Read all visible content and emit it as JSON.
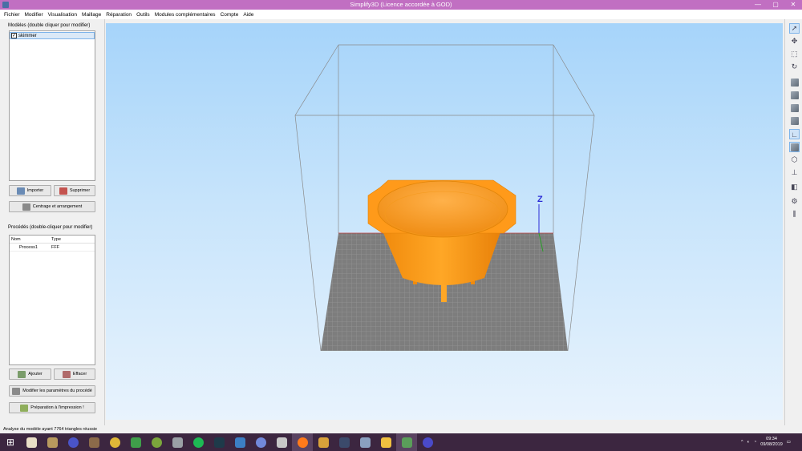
{
  "window": {
    "title": "Simplify3D (Licence accordée à GOD)",
    "controls": [
      "—",
      "▢",
      "✕"
    ]
  },
  "menu": [
    "Fichier",
    "Modifier",
    "Visualisation",
    "Maillage",
    "Réparation",
    "Outils",
    "Modules complémentaires",
    "Compte",
    "Aide"
  ],
  "models": {
    "title": "Modèles (double cliquer pour modifier)",
    "items": [
      {
        "name": "skimmer",
        "checked": true
      }
    ],
    "import_label": "Importer",
    "delete_label": "Supprimer",
    "arrange_label": "Centrage et arrangement"
  },
  "processes": {
    "title": "Procédés (double-cliquer pour modifier)",
    "col_name": "Nom",
    "col_type": "Type",
    "rows": [
      {
        "name": "Process1",
        "type": "FFF"
      }
    ],
    "add_label": "Ajouter",
    "clear_label": "Effacer",
    "edit_label": "Modifier les paramètres du procédé",
    "prepare_label": "Préparation à l'impression !"
  },
  "viewport": {
    "axis_label": "Z",
    "model_color": "#ff9a1a",
    "bed_color": "#7d7d7d"
  },
  "toolbar_icons": [
    "select-icon",
    "move-icon",
    "scale-icon",
    "rotate-icon",
    "view-default-icon",
    "view-front-icon",
    "view-top-icon",
    "view-side-icon",
    "axes-icon",
    "solid-icon",
    "wireframe-icon",
    "axis-indicator-icon",
    "cross-section-icon",
    "settings-gear-icon",
    "supports-icon"
  ],
  "status": {
    "text": "Analyse du modèle ayant 7764 triangles réussie"
  },
  "taskbar": {
    "time": "09:34",
    "date": "09/08/2019"
  }
}
